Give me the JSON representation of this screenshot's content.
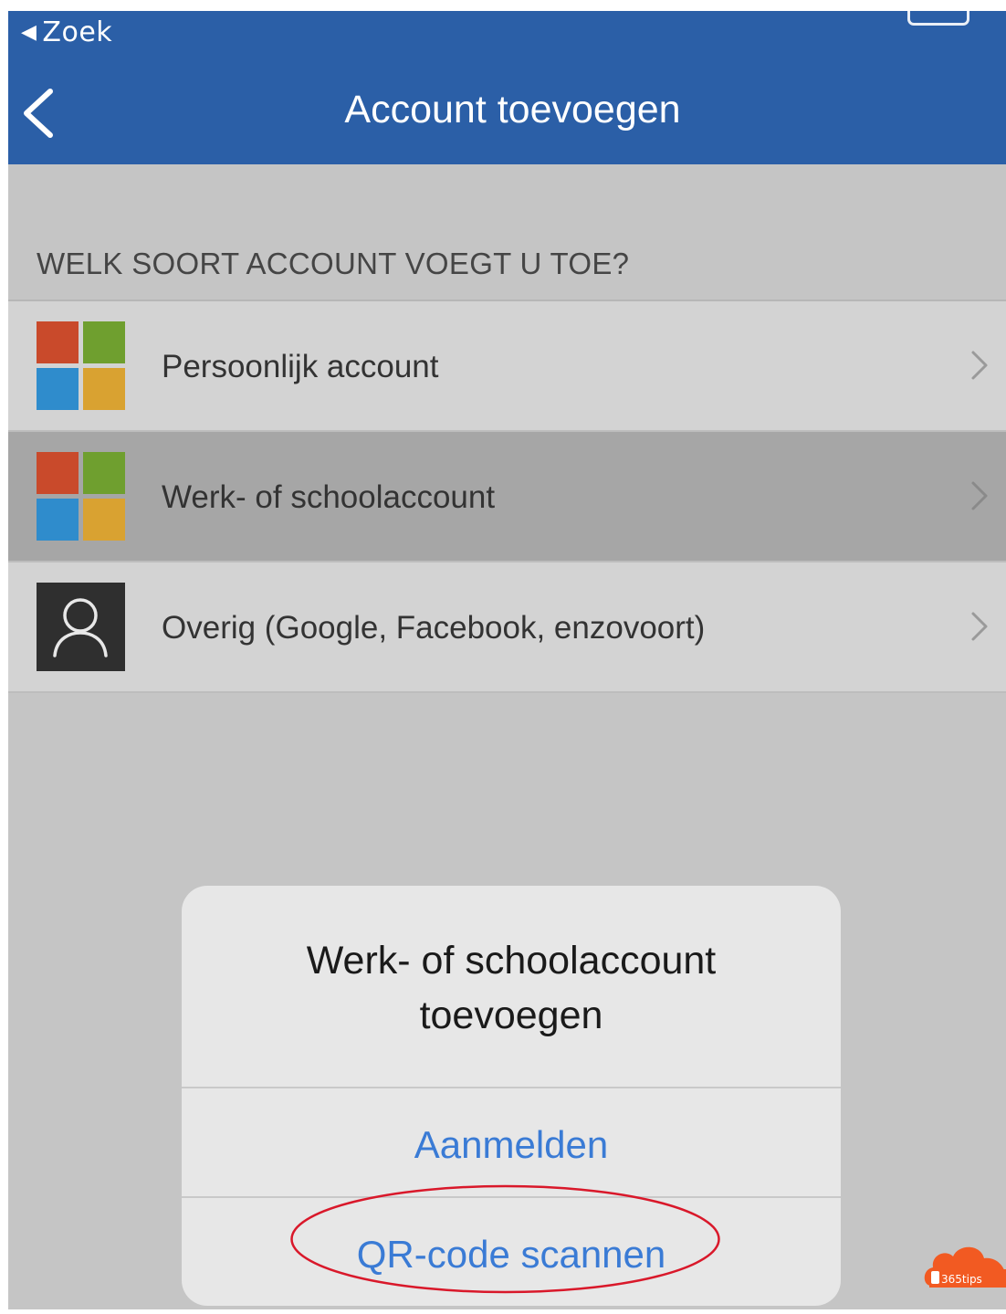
{
  "status_bar": {
    "back_app_label": "Zoek"
  },
  "nav": {
    "title": "Account toevoegen",
    "back_icon": "chevron-left-icon"
  },
  "section": {
    "label": "WELK SOORT ACCOUNT VOEGT U TOE?"
  },
  "accounts": [
    {
      "label": "Persoonlijk account",
      "icon": "microsoft-logo-icon",
      "selected": false
    },
    {
      "label": "Werk- of schoolaccount",
      "icon": "microsoft-logo-icon",
      "selected": true
    },
    {
      "label": "Overig (Google, Facebook, enzovoort)",
      "icon": "person-icon",
      "selected": false
    }
  ],
  "dialog": {
    "title_line1": "Werk- of schoolaccount",
    "title_line2": "toevoegen",
    "sign_in_label": "Aanmelden",
    "scan_qr_label": "QR-code scannen"
  },
  "watermark": {
    "text": "365tips"
  },
  "colors": {
    "header": "#2b5fa7",
    "dialog_button": "#3a7bd5",
    "highlight_ring": "#d9182a"
  }
}
